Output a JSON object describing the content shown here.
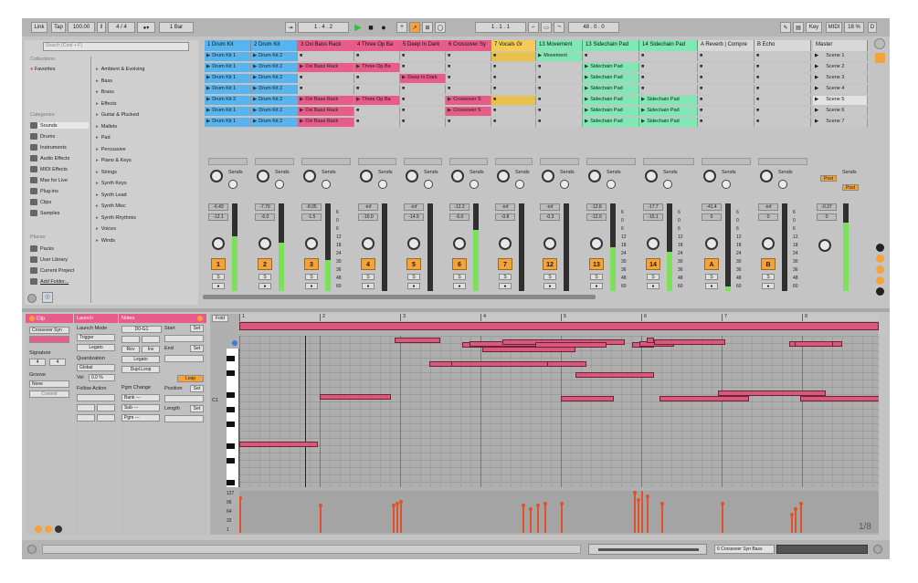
{
  "transport": {
    "link": "Link",
    "tap": "Tap",
    "tempo": "100.00",
    "signature": "4 / 4",
    "quantize": "1 Bar",
    "position": "1 . 4 . 2",
    "loop_start": "1 . 1 . 1",
    "loop_len": "48 . 0 . 0",
    "key": "Key",
    "midi": "MIDI",
    "cpu": "18 %",
    "d": "D"
  },
  "browser": {
    "search_placeholder": "Search (Cmd + F)",
    "collections_title": "Collections",
    "favorites": "Favorites",
    "categories_title": "Categories",
    "categories": [
      "Sounds",
      "Drums",
      "Instruments",
      "Audio Effects",
      "MIDI Effects",
      "Max for Live",
      "Plug-ins",
      "Clips",
      "Samples"
    ],
    "places_title": "Places",
    "places": [
      "Packs",
      "User Library",
      "Current Project",
      "Add Folder..."
    ],
    "items": [
      "Ambient & Evolving",
      "Bass",
      "Brass",
      "Effects",
      "Guitar & Plucked",
      "Mallets",
      "Pad",
      "Percussive",
      "Piano & Keys",
      "Strings",
      "Synth Keys",
      "Synth Lead",
      "Synth Misc",
      "Synth Rhythmic",
      "Voices",
      "Winds"
    ]
  },
  "tracks": [
    {
      "name": "1 Drum Kit",
      "color": "#58b4ee",
      "slots": [
        "Drum Kit 1",
        "Drum Kit 1",
        "Drum Kit 1",
        "Drum Kit 1",
        "Drum Kit 2",
        "Drum Kit 1",
        "Drum Kit 1"
      ],
      "vol": "-6.43",
      "pan": "-12.1",
      "num": "1",
      "fill": 0.62
    },
    {
      "name": "2 Drum Kit",
      "color": "#58b4ee",
      "slots": [
        "Drum Kit 2",
        "Drum Kit 2",
        "Drum Kit 2",
        "Drum Kit 2",
        "Drum Kit 2",
        "Drum Kit 2",
        "Drum Kit 2"
      ],
      "vol": "-7.70",
      "pan": "-6.0",
      "num": "2",
      "fill": 0.55
    },
    {
      "name": "3 Oxi Bass Rack",
      "color": "#e85c8a",
      "slots": [
        "",
        "Oxi Bass Rack",
        "",
        "",
        "Oxi Bass Rack",
        "Oxi Bass Rack",
        "Oxi Bass Rack"
      ],
      "vol": "-8.05",
      "pan": "-1.5",
      "num": "3",
      "fill": 0.35
    },
    {
      "name": "4 Three Op Ba",
      "color": "#e85c8a",
      "slots": [
        "",
        "Three Op Ba",
        "",
        "",
        "Three Op Ba",
        "",
        ""
      ],
      "vol": "-inf",
      "pan": "-16.0",
      "num": "4",
      "fill": 0.0
    },
    {
      "name": "5 Deep In Dark",
      "color": "#e85c8a",
      "slots": [
        "",
        "",
        "Deep In Dark",
        "",
        "",
        "",
        ""
      ],
      "vol": "-inf",
      "pan": "-14.9",
      "num": "5",
      "fill": 0.0
    },
    {
      "name": "6 Crossover Sy",
      "color": "#e85c8a",
      "slots": [
        "",
        "",
        "",
        "",
        "Crossover S",
        "Crossover S",
        ""
      ],
      "vol": "-12.2",
      "pan": "-6.0",
      "num": "6",
      "fill": 0.7
    },
    {
      "name": "7 Vocals Gr",
      "color": "#f6cb55",
      "slots": [
        "",
        "",
        "",
        "",
        "",
        "",
        ""
      ],
      "vol": "-inf",
      "pan": "-0.8",
      "num": "7",
      "fill": 0.0
    },
    {
      "name": "13 Movement",
      "color": "#7fe8b4",
      "slots": [
        "Movement",
        "",
        "",
        "",
        "",
        "",
        ""
      ],
      "vol": "-inf",
      "pan": "-0.3",
      "num": "12",
      "fill": 0.0
    },
    {
      "name": "13 Sidechain Pad",
      "color": "#7fe8b4",
      "slots": [
        "",
        "Sidechain Pad",
        "Sidechain Pad",
        "Sidechain Pad",
        "Sidechain Pad",
        "Sidechain Pad",
        "Sidechain Pad"
      ],
      "vol": "-12.8",
      "pan": "-12.0",
      "num": "13",
      "fill": 0.5
    },
    {
      "name": "14 Sidechain Pad",
      "color": "#7fe8b4",
      "slots": [
        "",
        "",
        "",
        "",
        "Sidechain Pad",
        "Sidechain Pad",
        "Sidechain Pad"
      ],
      "vol": "-17.7",
      "pan": "-15.1",
      "num": "14",
      "fill": 0.45
    },
    {
      "name": "A Reverb | Compre",
      "color": "#d8d8d8",
      "slots": [
        "",
        "",
        "",
        "",
        "",
        "",
        ""
      ],
      "vol": "-41.4",
      "pan": "0",
      "num": "A",
      "fill": 0.05
    },
    {
      "name": "B Echo",
      "color": "#d8d8d8",
      "slots": [
        "",
        "",
        "",
        "",
        "",
        "",
        ""
      ],
      "vol": "-inf",
      "pan": "0",
      "num": "B",
      "fill": 0.0
    }
  ],
  "master": {
    "name": "Master",
    "scenes": [
      "Scene 1",
      "Scene 2",
      "Scene 3",
      "Scene 4",
      "Scene 5",
      "Scene 6",
      "Scene 7"
    ],
    "vol": "-0.37",
    "pan": "0",
    "post": "Post"
  },
  "sends_label": "Sends",
  "meter_scale": [
    "6",
    "0",
    "6",
    "12",
    "18",
    "24",
    "30",
    "36",
    "48",
    "60"
  ],
  "clip": {
    "title": "Clip",
    "name": "Crossover Syn",
    "signature_title": "Signature",
    "sig_num": "4",
    "sig_den": "4",
    "groove_title": "Groove",
    "groove": "None",
    "commit": "Commit"
  },
  "launch": {
    "title": "Launch",
    "mode_title": "Launch Mode",
    "mode": "Trigger",
    "legato": "Legato",
    "quant_title": "Quantization",
    "quant": "Global",
    "vel_label": "Vel",
    "vel": "0.0 %",
    "follow_title": "Follow Action"
  },
  "notes": {
    "title": "Notes",
    "range": "D0-G1",
    "rev": "Rev",
    "inv": "Inv",
    "legato": "Legato",
    "dupl": "Dupl.Loop",
    "pgm_title": "Pgm Change",
    "bank": "Bank ---",
    "sub": "Sub ---",
    "pgm": "Pgm ---",
    "start_title": "Start",
    "set": "Set",
    "end_title": "End",
    "loop": "Loop",
    "position_title": "Position",
    "length_title": "Length"
  },
  "editor": {
    "fold": "Fold",
    "bars": [
      "1",
      "2",
      "3",
      "4",
      "5",
      "6",
      "7",
      "8"
    ],
    "c1": "C1",
    "vel_scale": [
      "127",
      "96",
      "64",
      "32",
      "1"
    ],
    "grid": "1/8"
  },
  "status": {
    "device": "6 Crossover Syn Bass"
  },
  "colors": {
    "accent": "#f4a23a",
    "pink": "#e85c8a",
    "blue": "#58b4ee",
    "green": "#7fe8b4",
    "note": "#d9587c",
    "velocity": "#e0532a",
    "meter": "#7be05a"
  }
}
